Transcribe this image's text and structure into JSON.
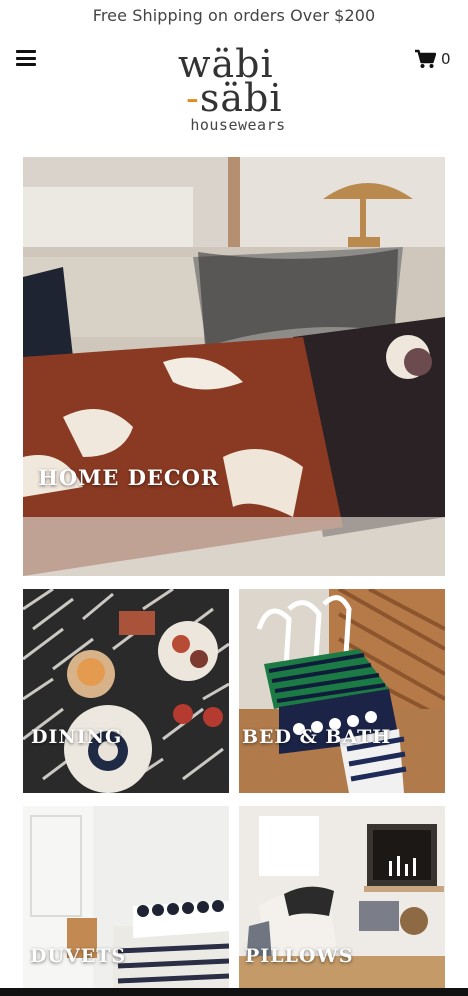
{
  "announcement": "Free Shipping on orders Over $200",
  "header": {
    "menu_icon": "hamburger-menu-icon",
    "logo": {
      "line1": "wäbi",
      "line2_dash": "-",
      "line2": "säbi",
      "line3": "housewears"
    },
    "cart_icon": "shopping-cart-icon",
    "cart_count": "0"
  },
  "categories": [
    {
      "label": "HOME DECOR"
    },
    {
      "label": "DINING"
    },
    {
      "label": "BED & BATH"
    },
    {
      "label": "DUVETS"
    },
    {
      "label": "PILLOWS"
    }
  ],
  "colors": {
    "accent": "#e48b1f",
    "text": "#222222"
  }
}
